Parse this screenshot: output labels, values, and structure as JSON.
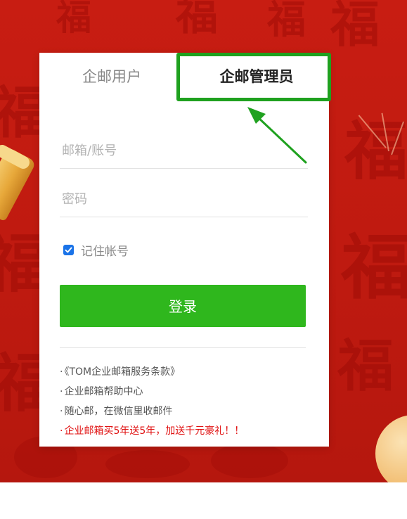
{
  "tabs": {
    "user_label": "企邮用户",
    "admin_label": "企邮管理员",
    "active": "admin"
  },
  "form": {
    "account_placeholder": "邮箱/账号",
    "password_placeholder": "密码",
    "remember_label": "记住帐号",
    "remember_checked": true,
    "login_label": "登录"
  },
  "links": [
    {
      "bullet": "·",
      "text": "《TOM企业邮箱服务条款》"
    },
    {
      "bullet": "·",
      "text": "企业邮箱帮助中心"
    },
    {
      "bullet": "·",
      "text": "随心邮，在微信里收邮件"
    },
    {
      "bullet": "·",
      "text": "企业邮箱买5年送5年，加送千元豪礼！！"
    }
  ],
  "colors": {
    "background_red": "#c81d12",
    "login_green": "#2fb71d",
    "highlight_green": "#1fa11f",
    "promo_red": "#e01010",
    "checkbox_blue": "#1a73e8"
  },
  "background": {
    "glyphs": [
      "福",
      "福",
      "福",
      "福",
      "福",
      "福",
      "福",
      "福",
      "福",
      "福"
    ]
  }
}
